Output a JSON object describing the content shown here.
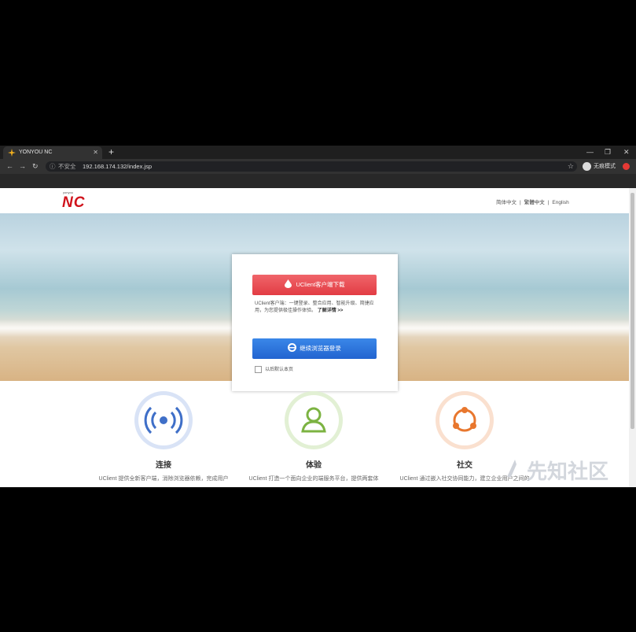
{
  "browser": {
    "tab_title": "YONYOU NC",
    "new_tab": "+",
    "address": {
      "security_text": "不安全",
      "url": "192.168.174.132/index.jsp"
    },
    "incognito_label": "无痕模式"
  },
  "header": {
    "brand_small": "yonyou",
    "brand": "NC",
    "languages": [
      "简体中文",
      "|",
      "繁體中文",
      "|",
      "English"
    ]
  },
  "login": {
    "download_label": "UClient客户端下载",
    "desc_text": "UClient客户端：一键登录、整合应用、智能升级、简捷应用，为您提供极佳操作体验。",
    "desc_link": "了解详情 >>",
    "browser_login_label": "继续浏览器登录",
    "remember_label": "以后默认本页"
  },
  "features": [
    {
      "title": "连接",
      "text": "UClient 提供全新客户端，消除浏览器依赖，完成用户",
      "color": "#3f6fc8"
    },
    {
      "title": "体验",
      "text": "UClient 打造一个面向企业的端服务平台，提供两套体",
      "color": "#7cb342"
    },
    {
      "title": "社交",
      "text": "UClient 通过嵌入社交协同能力，建立企业用户之间的",
      "color": "#e8772e"
    }
  ],
  "watermark": "先知社区",
  "colors": {
    "brand_red": "#d0121b",
    "btn_red": "#e23c44",
    "btn_blue": "#2264d0"
  }
}
